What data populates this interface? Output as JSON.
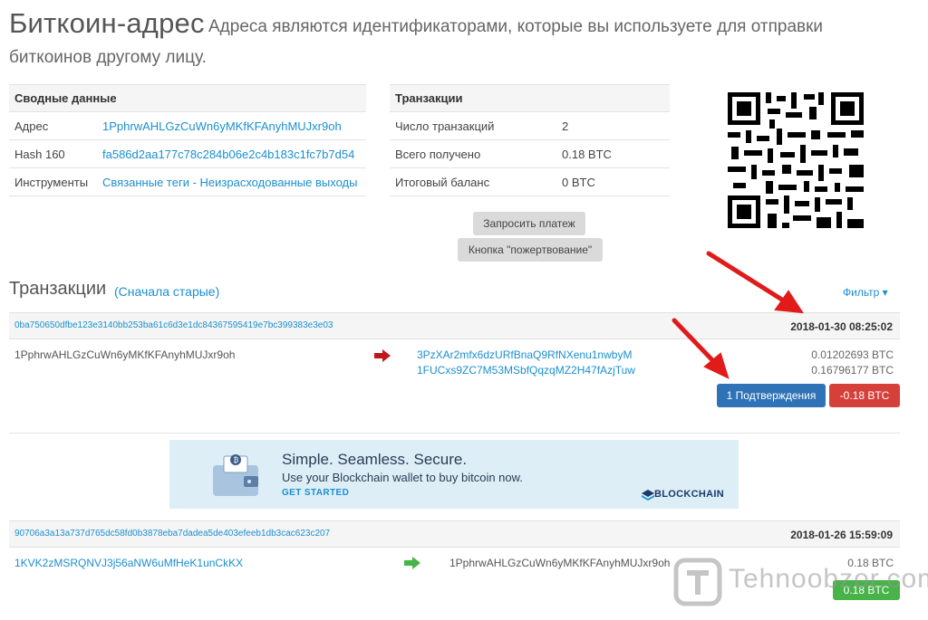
{
  "header": {
    "title": "Биткоин-адрес",
    "description_line1": "Адреса являются идентификаторами, которые вы используете для отправки",
    "description_line2": "биткоинов другому лицу."
  },
  "summary": {
    "heading": "Сводные данные",
    "rows": [
      {
        "label": "Адрес",
        "value": "1PphrwAHLGzCuWn6yMKfKFAnyhMUJxr9oh"
      },
      {
        "label": "Hash 160",
        "value": "fa586d2aa177c78c284b06e2c4b183c1fc7b7d54"
      },
      {
        "label": "Инструменты",
        "value": "Связанные теги",
        "value_sep": " - ",
        "value2": "Неизрасходованные выходы"
      }
    ]
  },
  "transactions_info": {
    "heading": "Транзакции",
    "rows": [
      {
        "label": "Число транзакций",
        "value": "2"
      },
      {
        "label": "Всего получено",
        "value": "0.18 BTC"
      },
      {
        "label": "Итоговый баланс",
        "value": "0 BTC"
      }
    ]
  },
  "buttons": {
    "request_payment": "Запросить платеж",
    "donate_button": "Кнопка \"пожертвование\""
  },
  "tx_section": {
    "title": "Транзакции",
    "order": "(Сначала старые)",
    "filter": "Фильтр ▾"
  },
  "tx": [
    {
      "hash": "0ba750650dfbe123e3140bb253ba61c6d3e1dc84367595419e7bc399383e3e03",
      "date": "2018-01-30 08:25:02",
      "from": "1PphrwAHLGzCuWn6yMKfKFAnyhMUJxr9oh",
      "to": [
        "3PzXAr2mfx6dzURfBnaQ9RfNXenu1nwbyM",
        "1FUCxs9ZC7M53MSbfQqzqMZ2H47fAzjTuw"
      ],
      "amounts": [
        "0.01202693 BTC",
        "0.16796177 BTC"
      ],
      "confirmations": "1 Подтверждения",
      "total": "-0.18 BTC"
    },
    {
      "hash": "90706a3a13a737d765dc58fd0b3878eba7dadea5de403efeeb1db3cac623c207",
      "date": "2018-01-26 15:59:09",
      "from": "1KVK2zMSRQNVJ3j56aNW6uMfHeK1unCkKX",
      "to": [
        "1PphrwAHLGzCuWn6yMKfKFAnyhMUJxr9oh"
      ],
      "amounts": [
        "0.18 BTC"
      ],
      "total": "0.18 BTC"
    }
  ],
  "banner": {
    "headline": "Simple. Seamless. Secure.",
    "subline": "Use your Blockchain wallet to buy bitcoin now.",
    "cta": "GET STARTED",
    "brand": "BLOCKCHAIN"
  },
  "watermark": {
    "text": "Tehnoobzor.com"
  },
  "colors": {
    "link": "#1c8fd0",
    "green": "#1b9a3a",
    "blue_button": "#2f72b6",
    "red_button": "#d6403b",
    "green_button": "#48b348",
    "arrow": "#e11a1a"
  },
  "icons": [
    "qr-code-icon",
    "arrow-right-red-icon",
    "arrow-right-green-icon",
    "wallet-icon",
    "blockchain-logo-icon",
    "annotation-arrow-icon"
  ]
}
